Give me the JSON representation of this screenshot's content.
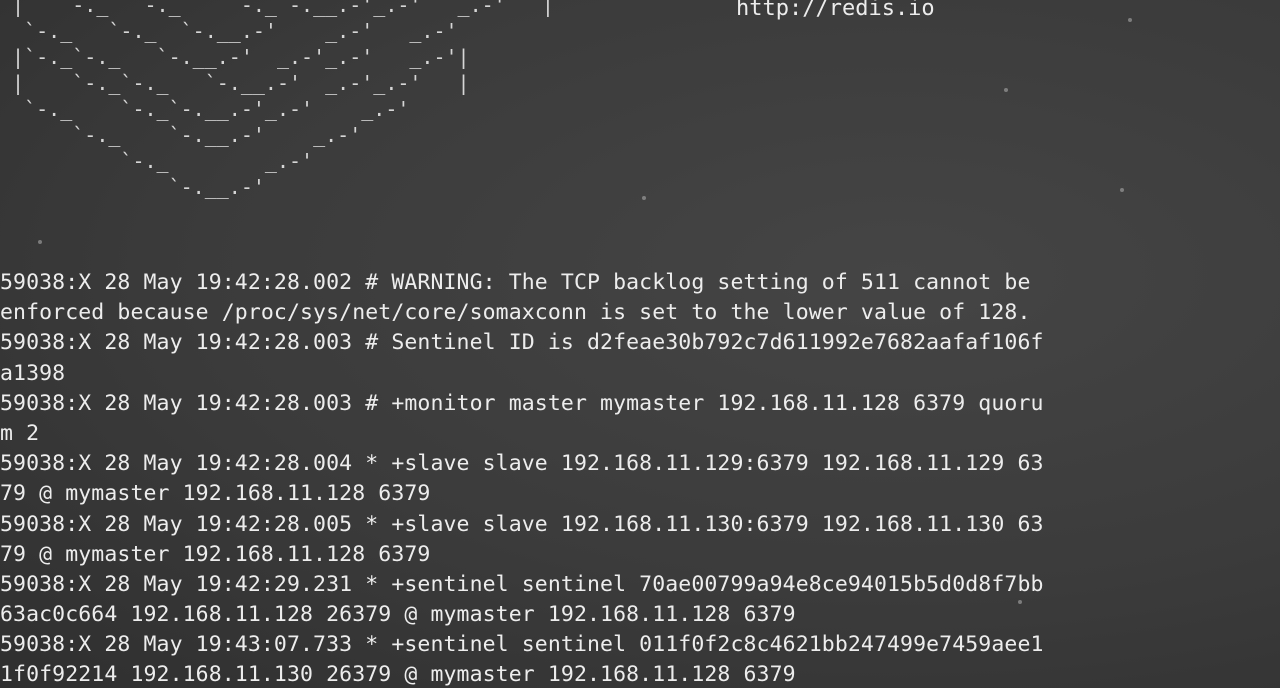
{
  "ascii_art": [
    " |   `-._  `-._    `-._`-.__.-'_.-'   _.-'   |",
    "  `-._   `-._  `-.__.-'    _.-'   _.-'",
    " |`-._`-._   `-.__.-'  _.-'_.-'   _.-'|",
    " |    `-._`-._   `-.__.-'  _.-'_.-'   |",
    "  `-._    `-._`-.__.-'_.-'    _.-'",
    "      `-._    `-.__.-'    _.-'",
    "          `-._        _.-'",
    "              `-.__.-'"
  ],
  "url": "http://redis.io",
  "log_lines": [
    "59038:X 28 May 19:42:28.002 # WARNING: The TCP backlog setting of 511 cannot be",
    "enforced because /proc/sys/net/core/somaxconn is set to the lower value of 128.",
    "59038:X 28 May 19:42:28.003 # Sentinel ID is d2feae30b792c7d611992e7682aafaf106f",
    "a1398",
    "59038:X 28 May 19:42:28.003 # +monitor master mymaster 192.168.11.128 6379 quoru",
    "m 2",
    "59038:X 28 May 19:42:28.004 * +slave slave 192.168.11.129:6379 192.168.11.129 63",
    "79 @ mymaster 192.168.11.128 6379",
    "59038:X 28 May 19:42:28.005 * +slave slave 192.168.11.130:6379 192.168.11.130 63",
    "79 @ mymaster 192.168.11.128 6379",
    "59038:X 28 May 19:42:29.231 * +sentinel sentinel 70ae00799a94e8ce94015b5d0d8f7bb",
    "63ac0c664 192.168.11.128 26379 @ mymaster 192.168.11.128 6379",
    "59038:X 28 May 19:43:07.733 * +sentinel sentinel 011f0f2c8c4621bb247499e7459aee1",
    "1f0f92214 192.168.11.130 26379 @ mymaster 192.168.11.128 6379"
  ]
}
